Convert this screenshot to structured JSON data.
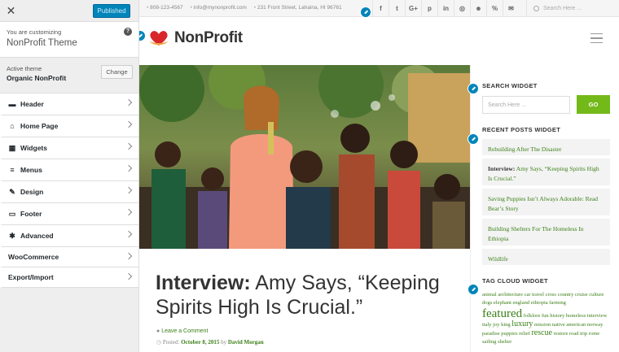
{
  "customizer": {
    "close_glyph": "✕",
    "publish_label": "Published",
    "customizing_label": "You are customizing",
    "theme_name": "NonProfit Theme",
    "help_glyph": "?",
    "active_theme_label": "Active theme",
    "active_theme_name": "Organic NonProfit",
    "change_label": "Change",
    "sections": [
      {
        "label": "Header",
        "icon": "header-icon"
      },
      {
        "label": "Home Page",
        "icon": "home-icon"
      },
      {
        "label": "Widgets",
        "icon": "widgets-icon"
      },
      {
        "label": "Menus",
        "icon": "menu-icon"
      },
      {
        "label": "Design",
        "icon": "brush-icon"
      },
      {
        "label": "Footer",
        "icon": "footer-icon"
      },
      {
        "label": "Advanced",
        "icon": "gear-icon"
      },
      {
        "label": "WooCommerce",
        "icon": ""
      },
      {
        "label": "Export/Import",
        "icon": ""
      }
    ]
  },
  "site": {
    "topbar": {
      "phone": "808-123-4567",
      "email": "info@mynonprofit.com",
      "address": "231 Front Street, Lahaina, HI 96761",
      "social": [
        "f",
        "t",
        "G+",
        "p",
        "in",
        "◎",
        "☻",
        "%",
        "✉"
      ],
      "search_placeholder": "Search Here ..."
    },
    "logo_text": "NonProfit",
    "post": {
      "title_bold": "Interview:",
      "title_rest": " Amy Says, “Keeping Spirits High Is Crucial.”",
      "comment_link": "Leave a Comment",
      "posted_label": "Posted:",
      "date": "October 8, 2015",
      "by_label": "by",
      "author": "David Morgan"
    },
    "widgets": {
      "search_title": "SEARCH WIDGET",
      "search_placeholder": "Search Here ...",
      "search_button": "GO",
      "recent_title": "RECENT POSTS WIDGET",
      "recent_posts": [
        {
          "bold": "",
          "text": "Rebuilding After The Disaster"
        },
        {
          "bold": "Interview:",
          "text": " Amy Says, “Keeping Spirits High Is Crucial.”"
        },
        {
          "bold": "",
          "text": "Saving Puppies Isn’t Always Adorable: Read Bear’s Story"
        },
        {
          "bold": "",
          "text": "Building Shelters For The Homeless In Ethiopia"
        },
        {
          "bold": "",
          "text": "Wildlife"
        }
      ],
      "tag_title": "TAG CLOUD WIDGET",
      "tags_line1": "animal architecture car travel cross country cruise culture dogs elephant england ethiopia farming",
      "tag_big": "featured",
      "tags_line2": " folklore fun history homeless interview italy joy king ",
      "tag_med": "luxury",
      "tags_line3": " mission native american norway paradise puppies relief ",
      "tag_med2": "rescue",
      "tags_line4": " restore road trip rome sailing shelter"
    }
  },
  "colors": {
    "accent_blue": "#0085ba",
    "green": "#74b91a",
    "link_green": "#3a7f17",
    "heart_red": "#d9262b"
  }
}
